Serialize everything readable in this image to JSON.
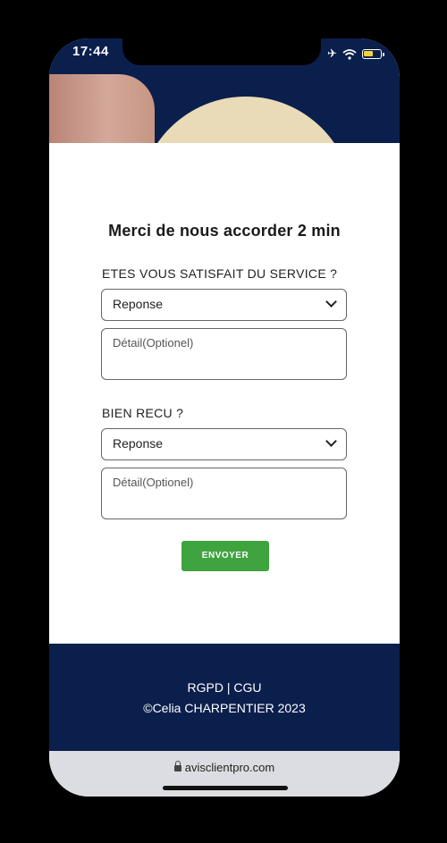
{
  "status_bar": {
    "time": "17:44",
    "icons": [
      "airplane-icon",
      "wifi-icon",
      "battery-icon"
    ]
  },
  "form": {
    "title": "Merci de nous accorder 2 min",
    "questions": [
      {
        "label": "ETES VOUS SATISFAIT DU SERVICE ?",
        "select_value": "Reponse",
        "detail_placeholder": "Détail(Optionel)"
      },
      {
        "label": "BIEN RECU ?",
        "select_value": "Reponse",
        "detail_placeholder": "Détail(Optionel)"
      }
    ],
    "submit_label": "ENVOYER"
  },
  "footer": {
    "links": "RGPD | CGU",
    "copyright": "©Celia CHARPENTIER  2023"
  },
  "browser": {
    "url": "avisclientpro.com"
  },
  "colors": {
    "navy": "#0b1f4d",
    "button_green": "#3fa33f"
  }
}
